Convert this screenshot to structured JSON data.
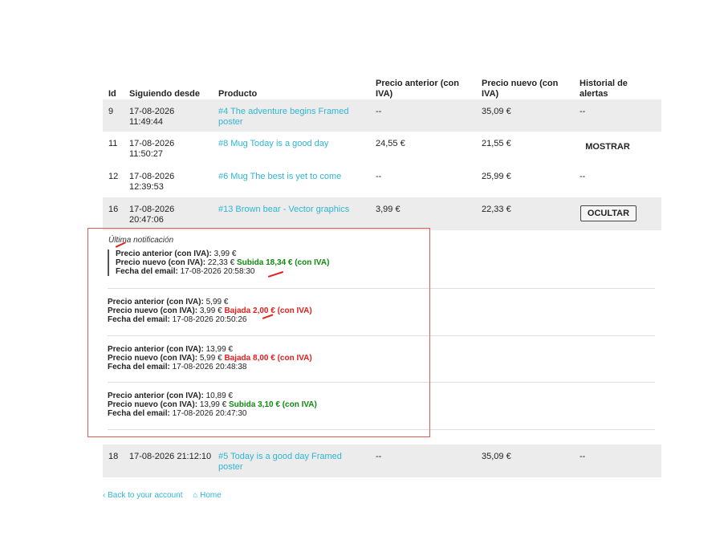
{
  "headers": {
    "id": "Id",
    "since": "Siguiendo desde",
    "product": "Producto",
    "old_price": "Precio anterior (con IVA)",
    "new_price": "Precio nuevo (con IVA)",
    "history": "Historial de alertas"
  },
  "rows": [
    {
      "id": "9",
      "date": "17-08-2026",
      "time": "11:49:44",
      "product_line1": "#4 The adventure begins Framed",
      "product_line2": "poster",
      "old": "--",
      "new": "35,09 €",
      "hist": "--"
    },
    {
      "id": "11",
      "date": "17-08-2026",
      "time": "11:50:27",
      "product_line1": "#8 Mug Today is a good day",
      "old": "24,55 €",
      "new": "21,55 €",
      "button": "MOSTRAR"
    },
    {
      "id": "12",
      "date": "17-08-2026",
      "time": "12:39:53",
      "product_line1": "#6 Mug The best is yet to come",
      "old": "--",
      "new": "25,99 €",
      "hist": "--"
    },
    {
      "id": "16",
      "date": "17-08-2026",
      "time": "20:47:06",
      "product_line1": "#13 Brown bear - Vector graphics",
      "old": "3,99 €",
      "new": "22,33 €",
      "button": "OCULTAR"
    },
    {
      "id": "18",
      "datetime": "17-08-2026 21:12:10",
      "product_line1": "#5 Today is a good day Framed",
      "product_line2": "poster",
      "old": "--",
      "new": "35,09 €",
      "hist": "--"
    }
  ],
  "history": {
    "last_label": "Última notificación",
    "labels": {
      "old": "Precio anterior (con IVA)",
      "new": "Precio nuevo (con IVA)",
      "email": "Fecha del email"
    },
    "entries": [
      {
        "old": "3,99 €",
        "new": "22,33 €",
        "change": "Subida 18,34 € (con IVA)",
        "email": "17-08-2026 20:58:30"
      },
      {
        "old": "5,99 €",
        "new": "3,99 €",
        "change": "Bajada 2,00 € (con IVA)",
        "email": "17-08-2026 20:50:26"
      },
      {
        "old": "13,99 €",
        "new": "5,99 €",
        "change": "Bajada 8,00 € (con IVA)",
        "email": "17-08-2026 20:48:38"
      },
      {
        "old": "10,89 €",
        "new": "13,99 €",
        "change": "Subida 3,10 € (con IVA)",
        "email": "17-08-2026 20:47:30"
      }
    ]
  },
  "footer": {
    "back": "‹ Back to your account",
    "home": "⌂ Home"
  },
  "colors": {
    "link": "#2fb5d2",
    "up": "#0f8a0f",
    "down": "#e0201d",
    "row_bg": "#ececec"
  }
}
